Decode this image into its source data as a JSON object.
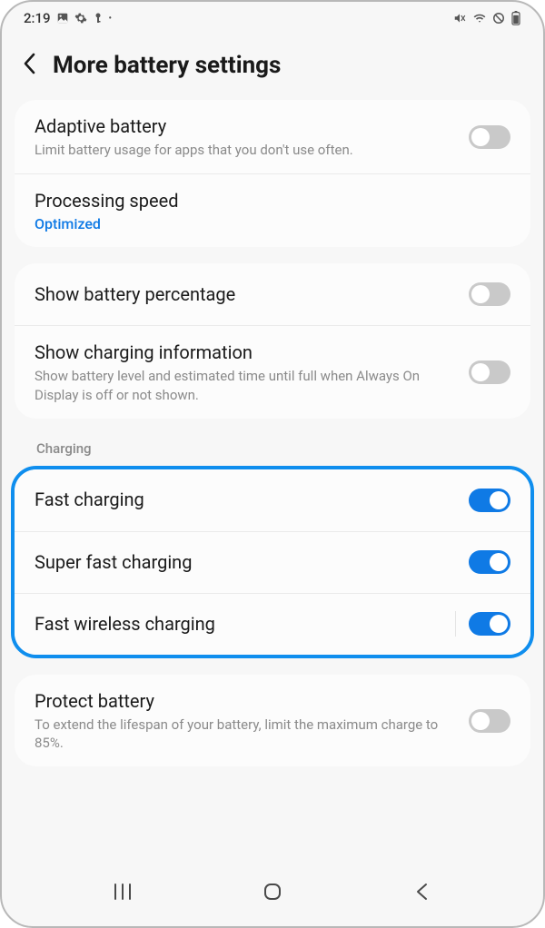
{
  "status_bar": {
    "time": "2:19",
    "icons_left": [
      "image-icon",
      "gear-icon",
      "key-icon",
      "dot-icon"
    ],
    "icons_right": [
      "mute-icon",
      "wifi-icon",
      "do-not-disturb-icon",
      "battery-icon"
    ]
  },
  "header": {
    "title": "More battery settings"
  },
  "groups": [
    {
      "rows": [
        {
          "name": "adaptive-battery",
          "title": "Adaptive battery",
          "sub": "Limit battery usage for apps that you don't use often.",
          "toggle": false
        },
        {
          "name": "processing-speed",
          "title": "Processing speed",
          "value": "Optimized"
        }
      ]
    },
    {
      "rows": [
        {
          "name": "show-battery-percentage",
          "title": "Show battery percentage",
          "toggle": false
        },
        {
          "name": "show-charging-information",
          "title": "Show charging information",
          "sub": "Show battery level and estimated time until full when Always On Display is off or not shown.",
          "toggle": false
        }
      ]
    },
    {
      "section_label": "Charging",
      "highlighted": true,
      "rows": [
        {
          "name": "fast-charging",
          "title": "Fast charging",
          "toggle": true
        },
        {
          "name": "super-fast-charging",
          "title": "Super fast charging",
          "toggle": true
        },
        {
          "name": "fast-wireless-charging",
          "title": "Fast wireless charging",
          "toggle": true,
          "separator_before_toggle": true
        }
      ]
    },
    {
      "rows": [
        {
          "name": "protect-battery",
          "title": "Protect battery",
          "sub": "To extend the lifespan of your battery, limit the maximum charge to 85%.",
          "toggle": false
        }
      ]
    }
  ],
  "nav": {
    "recents": "recents",
    "home": "home",
    "back": "back"
  }
}
